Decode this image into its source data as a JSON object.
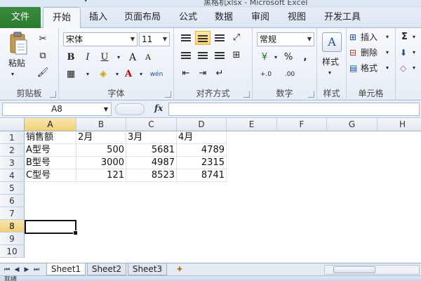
{
  "window": {
    "title": "黑格机xlsx - Microsoft Excel"
  },
  "tabs": [
    {
      "label": "文件"
    },
    {
      "label": "开始"
    },
    {
      "label": "插入"
    },
    {
      "label": "页面布局"
    },
    {
      "label": "公式"
    },
    {
      "label": "数据"
    },
    {
      "label": "审阅"
    },
    {
      "label": "视图"
    },
    {
      "label": "开发工具"
    }
  ],
  "ribbon": {
    "clipboard": {
      "label": "剪贴板",
      "paste": "粘贴"
    },
    "font": {
      "label": "字体",
      "font_name": "宋体",
      "font_size": "11",
      "bold": "B",
      "italic": "I",
      "underline": "U",
      "grow": "A",
      "shrink": "A",
      "wen": "wén"
    },
    "alignment": {
      "label": "对齐方式"
    },
    "number": {
      "label": "数字",
      "format": "常规",
      "percent": "%",
      "comma": ",",
      "inc_decimal": "+.0",
      "dec_decimal": ".00"
    },
    "styles": {
      "label": "样式",
      "style_btn": "样式"
    },
    "cells": {
      "label": "单元格",
      "insert": "插入",
      "delete": "删除",
      "format": "格式"
    },
    "editing": {
      "sum": "Σ"
    }
  },
  "formula_bar": {
    "name_box": "A8",
    "fx": "fx",
    "formula": ""
  },
  "grid": {
    "columns": [
      "A",
      "B",
      "C",
      "D",
      "E",
      "F",
      "G",
      "H"
    ],
    "selected_column": "A",
    "rows": [
      "1",
      "2",
      "3",
      "4",
      "5",
      "6",
      "7",
      "8",
      "9",
      "10"
    ],
    "selected_row": "8",
    "data": [
      [
        "销售额",
        "2月",
        "3月",
        "4月"
      ],
      [
        "A型号",
        "500",
        "5681",
        "4789"
      ],
      [
        "B型号",
        "3000",
        "4987",
        "2315"
      ],
      [
        "C型号",
        "121",
        "8523",
        "8741"
      ]
    ],
    "active_cell": "A8"
  },
  "sheets": [
    {
      "label": "Sheet1",
      "active": true
    },
    {
      "label": "Sheet2",
      "active": false
    },
    {
      "label": "Sheet3",
      "active": false
    }
  ],
  "status": {
    "text": "就绪"
  },
  "colors": {
    "file_tab": "#2a7a2f",
    "selected_header": "#f1cf73",
    "active_border": "#111111"
  }
}
